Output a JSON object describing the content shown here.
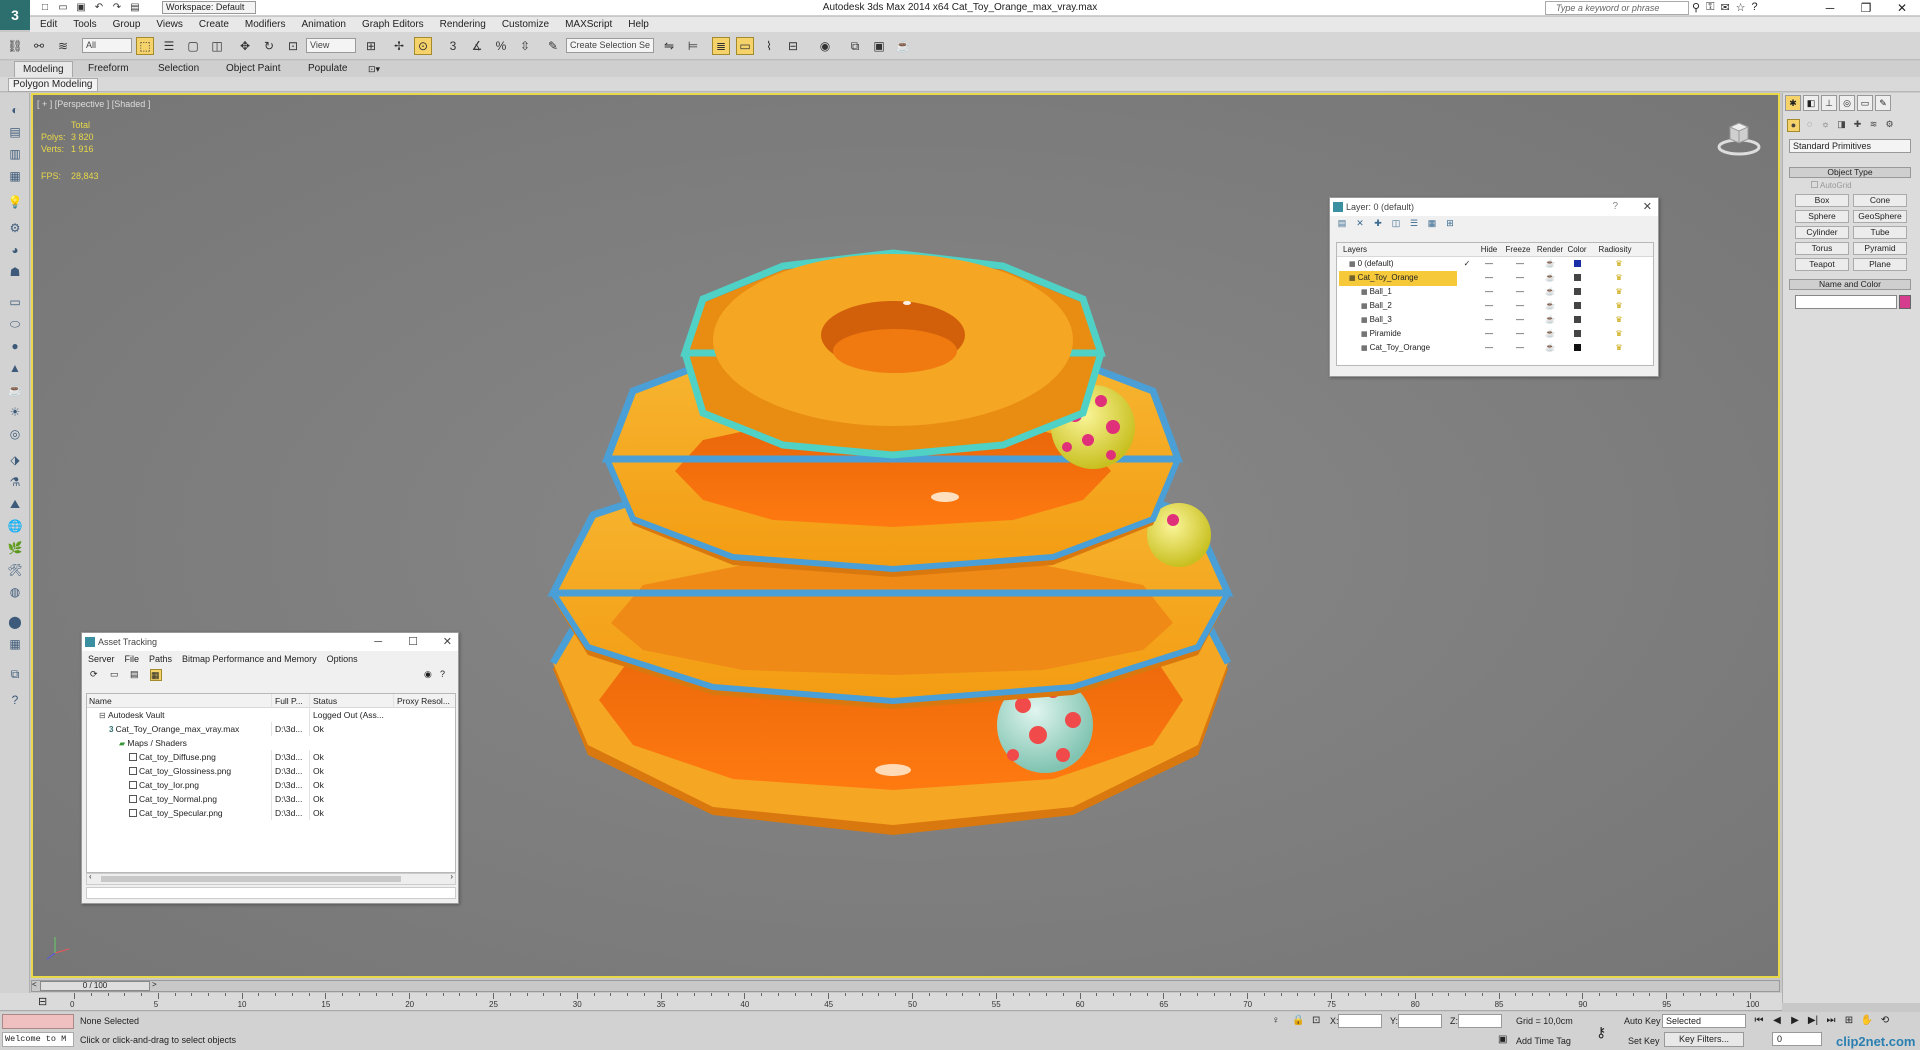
{
  "titlebar": {
    "app_icon": "3",
    "workspace": "Workspace: Default",
    "title": "Autodesk 3ds Max  2014 x64     Cat_Toy_Orange_max_vray.max",
    "search_placeholder": "Type a keyword or phrase"
  },
  "menu": [
    "Edit",
    "Tools",
    "Group",
    "Views",
    "Create",
    "Modifiers",
    "Animation",
    "Graph Editors",
    "Rendering",
    "Customize",
    "MAXScript",
    "Help"
  ],
  "toolbar": {
    "filter": "All",
    "refcoord": "View",
    "named_selection": "Create Selection Se"
  },
  "ribbon": {
    "tabs": [
      "Modeling",
      "Freeform",
      "Selection",
      "Object Paint",
      "Populate"
    ],
    "panel": "Polygon Modeling"
  },
  "viewport": {
    "label": "[ + ] [Perspective ] [Shaded ]",
    "stats_header": "Total",
    "polys_label": "Polys:",
    "polys": "3 820",
    "verts_label": "Verts:",
    "verts": "1 916",
    "fps_label": "FPS:",
    "fps": "28,843"
  },
  "layer_dialog": {
    "title": "Layer: 0 (default)",
    "columns": [
      "Layers",
      "Hide",
      "Freeze",
      "Render",
      "Color",
      "Radiosity"
    ],
    "rows": [
      {
        "name": "0 (default)",
        "check": "✓",
        "color": "#1a2ea8",
        "selected": false
      },
      {
        "name": "Cat_Toy_Orange",
        "check": "",
        "color": "#444444",
        "selected": true
      },
      {
        "name": "Ball_1",
        "check": "",
        "color": "#444444",
        "selected": false
      },
      {
        "name": "Ball_2",
        "check": "",
        "color": "#444444",
        "selected": false
      },
      {
        "name": "Ball_3",
        "check": "",
        "color": "#444444",
        "selected": false
      },
      {
        "name": "Piramide",
        "check": "",
        "color": "#444444",
        "selected": false
      },
      {
        "name": "Cat_Toy_Orange",
        "check": "",
        "color": "#111111",
        "selected": false
      }
    ]
  },
  "asset_dialog": {
    "title": "Asset Tracking",
    "menu": [
      "Server",
      "File",
      "Paths",
      "Bitmap Performance and Memory",
      "Options"
    ],
    "columns": [
      "Name",
      "Full P...",
      "Status",
      "Proxy Resol..."
    ],
    "rows": [
      {
        "name": "Autodesk Vault",
        "path": "",
        "status": "Logged Out (Ass...",
        "indent": 1
      },
      {
        "name": "Cat_Toy_Orange_max_vray.max",
        "path": "D:\\3d...",
        "status": "Ok",
        "indent": 2
      },
      {
        "name": "Maps / Shaders",
        "path": "",
        "status": "",
        "indent": 3
      },
      {
        "name": "Cat_toy_Diffuse.png",
        "path": "D:\\3d...",
        "status": "Ok",
        "indent": 4
      },
      {
        "name": "Cat_toy_Glossiness.png",
        "path": "D:\\3d...",
        "status": "Ok",
        "indent": 4
      },
      {
        "name": "Cat_toy_Ior.png",
        "path": "D:\\3d...",
        "status": "Ok",
        "indent": 4
      },
      {
        "name": "Cat_toy_Normal.png",
        "path": "D:\\3d...",
        "status": "Ok",
        "indent": 4
      },
      {
        "name": "Cat_toy_Specular.png",
        "path": "D:\\3d...",
        "status": "Ok",
        "indent": 4
      }
    ]
  },
  "command_panel": {
    "category": "Standard Primitives",
    "object_type": "Object Type",
    "autogrid": "AutoGrid",
    "primitives": [
      "Box",
      "Cone",
      "Sphere",
      "GeoSphere",
      "Cylinder",
      "Tube",
      "Torus",
      "Pyramid",
      "Teapot",
      "Plane"
    ],
    "name_color": "Name and Color",
    "object_color": "#d63c8e"
  },
  "timeline": {
    "slider": "0 / 100",
    "ticks": [
      "0",
      "5",
      "10",
      "15",
      "20",
      "25",
      "30",
      "35",
      "40",
      "45",
      "50",
      "55",
      "60",
      "65",
      "70",
      "75",
      "80",
      "85",
      "90",
      "95",
      "100"
    ]
  },
  "status": {
    "maxscript": "Welcome to M",
    "selection": "None Selected",
    "prompt": "Click or click-and-drag to select objects",
    "x_label": "X:",
    "y_label": "Y:",
    "z_label": "Z:",
    "grid": "Grid = 10,0cm",
    "add_time_tag": "Add Time Tag",
    "auto_key": "Auto Key",
    "set_key": "Set Key",
    "selected": "Selected",
    "key_filters": "Key Filters...",
    "frame": "0",
    "watermark": "clip2net.com"
  },
  "colors": {
    "viewport_bg": "#7f7f7f",
    "viewport_border": "#e8d84a",
    "stats_text": "#e8d84a",
    "toy_orange": "#f5a623",
    "toy_deep_orange": "#f07a10",
    "rim_blue": "#4a9fd6",
    "rim_cyan": "#4fd1c5"
  }
}
